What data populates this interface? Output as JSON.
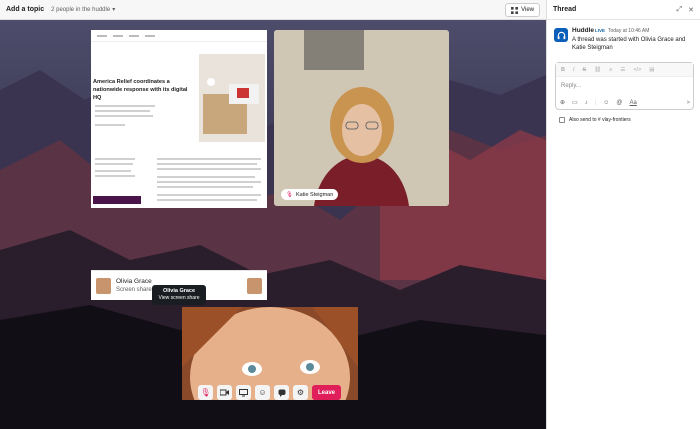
{
  "topbar": {
    "title": "Add a topic",
    "people": "2 people in the huddle",
    "view_label": "View"
  },
  "share": {
    "headline": "America Relief coordinates a\nnationwide response with its digital HQ",
    "presenter": "Olivia Grace",
    "subtitle": "Screen share"
  },
  "katie": {
    "name": "Katie Steigman"
  },
  "tooltip": {
    "name": "Olivia Grace",
    "action": "View screen share"
  },
  "controls": {
    "leave_label": "Leave"
  },
  "thread": {
    "title": "Thread",
    "message": {
      "author": "Huddle",
      "badge": "LIVE",
      "time": "Today at 10:46 AM",
      "body": "A thread was started with Olivia Grace and Katie Steigman"
    },
    "composer": {
      "placeholder": "Reply..."
    },
    "also_send": "Also send to # vlay-frontiers"
  },
  "colors": {
    "leave": "#e01e5a",
    "accent": "#1264a3",
    "aubergine": "#4a154b"
  }
}
